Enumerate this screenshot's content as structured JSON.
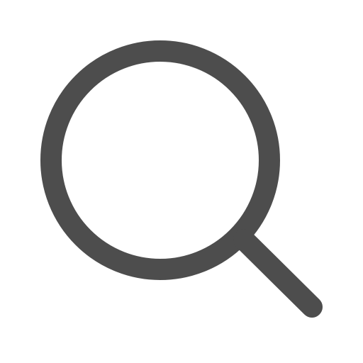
{
  "icon": {
    "name": "search-icon",
    "stroke_color": "#4d4d4d",
    "background_color": "#ffffff"
  }
}
